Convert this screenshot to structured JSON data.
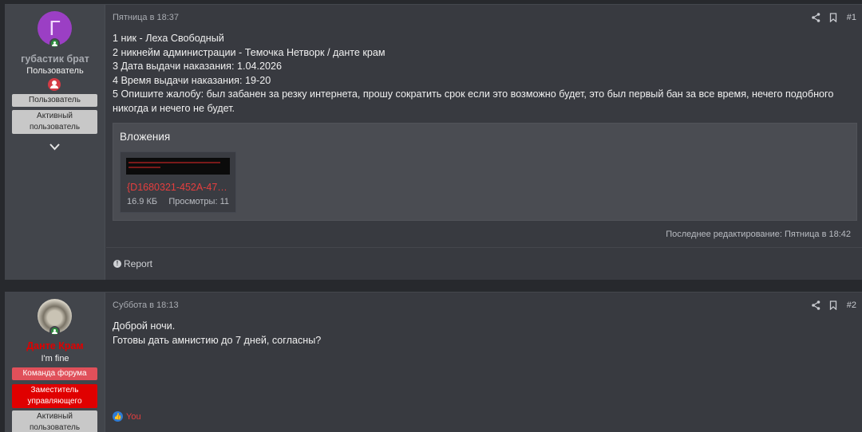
{
  "posts": [
    {
      "author": {
        "name": "губастик брат",
        "avatar_letter": "Г",
        "title": "Пользователь",
        "banners": [
          "Пользователь",
          "Активный пользователь"
        ],
        "name_color": "#a7aab0"
      },
      "date": "Пятница в 18:37",
      "number": "#1",
      "lines": [
        "1 ник - Леха Свободный",
        "2 никнейм администрации - Темочка Нетворк / данте крам",
        "3 Дата выдачи наказания: 1.04.2026",
        "4 Время выдачи наказания: 19-20",
        "5 Опишите жалобу: был забанен за резку интернета, прошу сократить срок если это возможно будет, это был первый бан за все время, нечего подобного никогда и нечего не будет."
      ],
      "attachments_title": "Вложения",
      "attachment": {
        "filename": "{D1680321-452A-47B…",
        "size": "16.9 КБ",
        "views": "Просмотры: 11"
      },
      "last_edited": "Последнее редактирование: Пятница в 18:42",
      "report_label": "Report"
    },
    {
      "author": {
        "name": "Данте Крам",
        "title": "I'm fine",
        "banners": [
          "Команда форума",
          "Заместитель управляющего",
          "Активный пользователь"
        ],
        "name_color": "#e00000"
      },
      "date": "Суббота в 18:13",
      "number": "#2",
      "lines": [
        "Доброй ночи.",
        "Готовы дать амнистию до 7 дней, согласны?"
      ],
      "reaction_label": "You"
    }
  ],
  "colors": {
    "accent_red": "#e53e3e",
    "background": "#27292d",
    "post_bg": "#383a40"
  },
  "icons": [
    "share-icon",
    "bookmark-icon",
    "chevron-down-icon",
    "online-icon",
    "user-badge-icon",
    "report-icon",
    "like-icon"
  ]
}
